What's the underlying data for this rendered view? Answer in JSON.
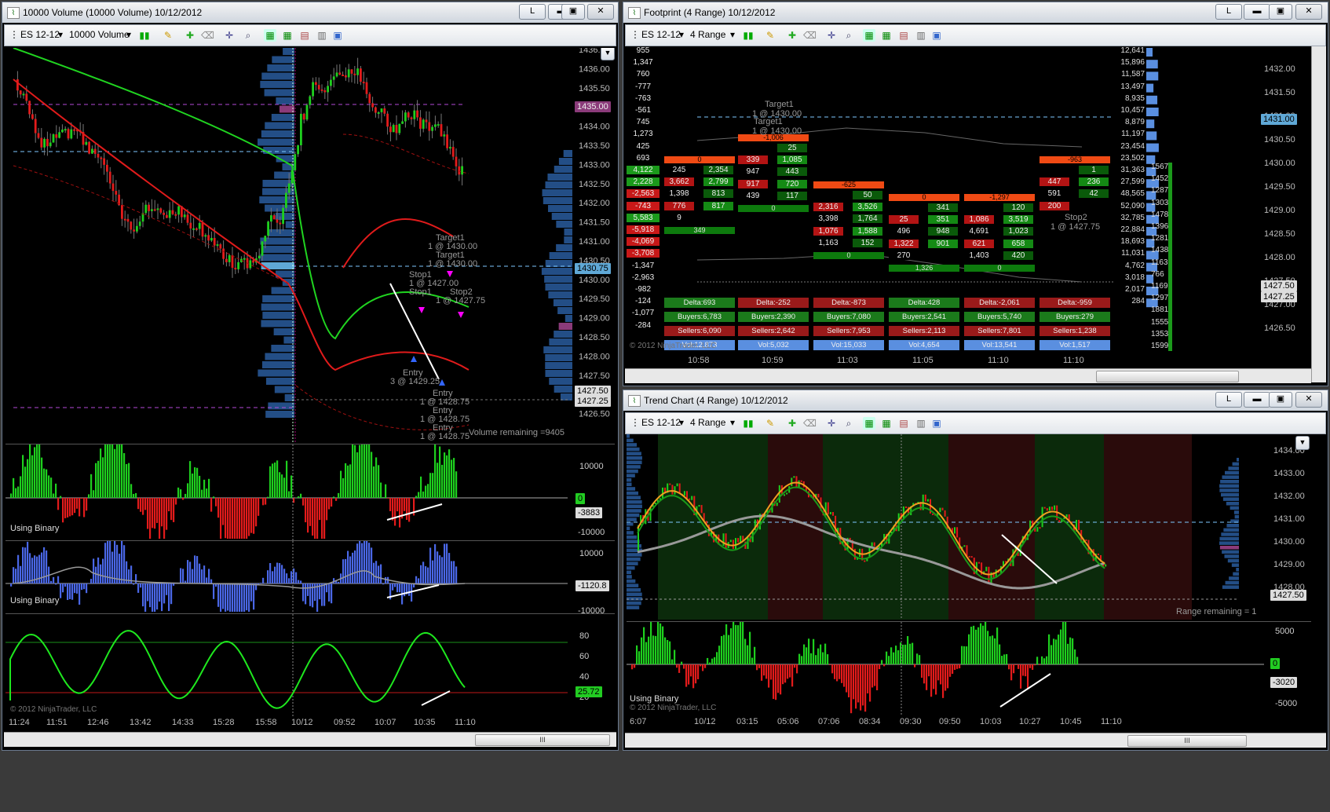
{
  "left_window": {
    "title": "10000 Volume (10000 Volume)  10/12/2012",
    "toolbar": {
      "instrument": "ES 12-12",
      "period": "10000 Volume"
    },
    "price_axis": [
      "1436.50",
      "1436.00",
      "1435.50",
      "1434.50",
      "1434.00",
      "1433.50",
      "1433.00",
      "1432.50",
      "1432.00",
      "1431.50",
      "1431.00",
      "1430.50",
      "1430.00",
      "1429.50",
      "1429.00",
      "1428.50",
      "1428.00",
      "1427.50",
      "1427.25",
      "1426.50"
    ],
    "price_tags": {
      "top": "1435.00",
      "mid": "1430.75",
      "last": "1427.50",
      "last2": "1427.25"
    },
    "annotations": {
      "target1a": "Target1",
      "target1a_val": "1 @ 1430.00",
      "target1b": "Target1",
      "target1b_val": "1 @ 1430.00",
      "stop1": "Stop1",
      "stop1_val": "1 @ 1427.00",
      "stop2_a": "Stop1",
      "stop2_a_val": "1 @ 1427.75",
      "stop2": "Stop2",
      "entry_main": "Entry",
      "entry_main_val": "3 @ 1429.25",
      "entry1": "Entry",
      "entry1_val": "1 @ 1428.75",
      "entry2": "Entry",
      "entry2_val": "1 @ 1428.75",
      "entry3": "Entry",
      "entry3_val": "1 @ 1428.75",
      "vol_remaining": "Volume remaining =9405"
    },
    "panel1": {
      "label": "Using Binary",
      "ticks": [
        "10000",
        "-10000"
      ],
      "tag_zero": "0",
      "tag_val": "-3883"
    },
    "panel2": {
      "label": "Using Binary",
      "ticks": [
        "10000",
        "-10000"
      ],
      "tag_val": "-1120.8"
    },
    "panel3": {
      "ticks": [
        "80",
        "60",
        "40",
        "20"
      ],
      "tag_val": "25.72"
    },
    "copyright": "© 2012 NinjaTrader, LLC",
    "time_axis": [
      "11:24",
      "11:51",
      "12:46",
      "13:42",
      "14:33",
      "15:28",
      "15:58",
      "10/12",
      "09:52",
      "10:07",
      "10:35",
      "11:10"
    ],
    "scroll_thumb": "III"
  },
  "footprint_window": {
    "title": "Footprint (4 Range)  10/12/2012",
    "toolbar": {
      "instrument": "ES 12-12",
      "period": "4 Range"
    },
    "delta_col": [
      "955",
      "1,347",
      "760",
      "-777",
      "-763",
      "-561",
      "745",
      "1,273",
      "425",
      "693",
      "4,122",
      "2,228",
      "-2,563",
      "-743",
      "5,583",
      "-5,918",
      "-4,069",
      "-3,708",
      "-1,347",
      "-2,963",
      "-982",
      "-124",
      "-1,077",
      "-284"
    ],
    "vol_col": [
      "12,641",
      "15,896",
      "11,587",
      "13,497",
      "8,935",
      "10,457",
      "8,879",
      "11,197",
      "23,454",
      "23,502",
      "31,363",
      "27,599",
      "48,565",
      "52,090",
      "32,785",
      "22,884",
      "18,693",
      "11,031",
      "4,762",
      "3,018",
      "2,017",
      "284"
    ],
    "right_col": [
      "1567",
      "1452",
      "1287",
      "1303",
      "1478",
      "1396",
      "1281",
      "1438",
      "1163",
      "766",
      "1169",
      "1297",
      "1881",
      "1555",
      "1353",
      "1599"
    ],
    "price_axis": [
      "1432.00",
      "1431.50",
      "1431.00",
      "1430.50",
      "1430.00",
      "1429.50",
      "1429.00",
      "1428.50",
      "1428.00",
      "1427.50",
      "1427.00",
      "1426.50"
    ],
    "price_tags": {
      "a": "1431.00",
      "b": "1427.50",
      "c": "1427.25"
    },
    "targets": {
      "t1": "Target1",
      "t1v": "1 @ 1430.00",
      "t2": "Target1",
      "t2v": "1 @ 1430.00",
      "stop2": "Stop2",
      "stop2v": "1 @ 1427.75"
    },
    "bars": [
      {
        "time": "10:58",
        "top": "0",
        "rows": [
          [
            "245",
            "2,354"
          ],
          [
            "3,662",
            "2,799"
          ],
          [
            "1,398",
            "813"
          ],
          [
            "776",
            "817"
          ],
          [
            "9",
            ""
          ]
        ],
        "bottom": "349",
        "delta": "Delta:693",
        "buyers": "Buyers:6,783",
        "sellers": "Sellers:6,090",
        "vol": "Vol:12,873"
      },
      {
        "time": "10:59",
        "top": "-1,006",
        "rows": [
          [
            "",
            "25"
          ],
          [
            "339",
            "1,085"
          ],
          [
            "947",
            "443"
          ],
          [
            "917",
            "720"
          ],
          [
            "439",
            "117"
          ]
        ],
        "bottom": "0",
        "delta": "Delta:-252",
        "buyers": "Buyers:2,390",
        "sellers": "Sellers:2,642",
        "vol": "Vol:5,032"
      },
      {
        "time": "11:03",
        "top": "-625",
        "rows": [
          [
            "",
            "50"
          ],
          [
            "2,316",
            "3,526"
          ],
          [
            "3,398",
            "1,764"
          ],
          [
            "1,076",
            "1,588"
          ],
          [
            "1,163",
            "152"
          ]
        ],
        "bottom": "0",
        "delta": "Delta:-873",
        "buyers": "Buyers:7,080",
        "sellers": "Sellers:7,953",
        "vol": "Vol:15,033"
      },
      {
        "time": "11:05",
        "top": "0",
        "rows": [
          [
            "",
            "341"
          ],
          [
            "25",
            "351"
          ],
          [
            "496",
            "948"
          ],
          [
            "1,322",
            "901"
          ],
          [
            "270",
            ""
          ]
        ],
        "bottom": "1,326",
        "delta": "Delta:428",
        "buyers": "Buyers:2,541",
        "sellers": "Sellers:2,113",
        "vol": "Vol:4,654"
      },
      {
        "time": "11:10",
        "top": "-1,297",
        "rows": [
          [
            "",
            "120"
          ],
          [
            "1,086",
            "3,519"
          ],
          [
            "4,691",
            "1,023"
          ],
          [
            "621",
            "658"
          ],
          [
            "1,403",
            "420"
          ]
        ],
        "bottom": "0",
        "delta": "Delta:-2,061",
        "buyers": "Buyers:5,740",
        "sellers": "Sellers:7,801",
        "vol": "Vol:13,541"
      },
      {
        "time": "11:10",
        "top": "-963",
        "rows": [
          [
            "",
            "1"
          ],
          [
            "447",
            "236"
          ],
          [
            "591",
            "42"
          ],
          [
            "200",
            ""
          ]
        ],
        "bottom": "",
        "delta": "Delta:-959",
        "buyers": "Buyers:279",
        "sellers": "Sellers:1,238",
        "vol": "Vol:1,517"
      }
    ],
    "copyright": "© 2012 NinjaTrader, LLC"
  },
  "trend_window": {
    "title": "Trend Chart (4 Range)  10/12/2012",
    "toolbar": {
      "instrument": "ES 12-12",
      "period": "4 Range"
    },
    "price_axis": [
      "1434.00",
      "1433.00",
      "1432.00",
      "1431.00",
      "1430.00",
      "1429.00",
      "1428.00"
    ],
    "price_tag": "1427.50",
    "range_remaining": "Range remaining = 1",
    "panel": {
      "label": "Using Binary",
      "ticks": [
        "5000",
        "-5000"
      ],
      "tag_zero": "0",
      "tag_val": "-3020"
    },
    "copyright": "© 2012 NinjaTrader, LLC",
    "time_axis": [
      "6:07",
      "10/12",
      "03:15",
      "05:06",
      "07:06",
      "08:34",
      "09:30",
      "09:50",
      "10:03",
      "10:27",
      "10:45",
      "11:10"
    ],
    "scroll_thumb": "III"
  },
  "window_buttons": {
    "layout": "L",
    "min": "▬",
    "max": "▣",
    "close": "✕"
  },
  "icons": [
    "chart-icon",
    "dropdown-icon",
    "bars-icon",
    "pencil-icon",
    "crosshair-icon",
    "zoom-icon",
    "properties-icon"
  ]
}
